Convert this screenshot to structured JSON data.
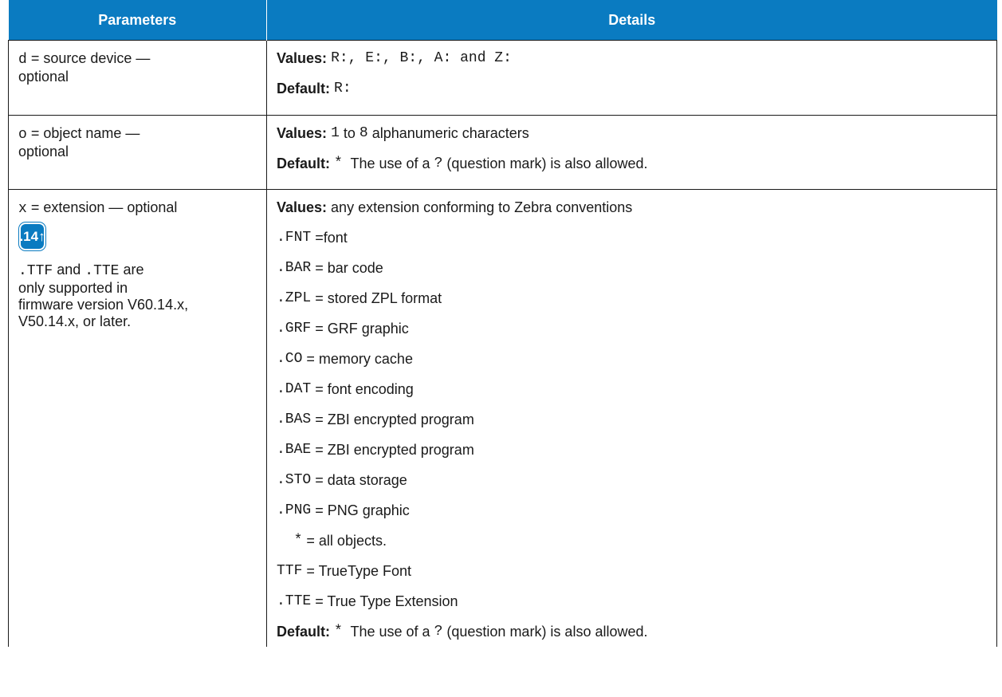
{
  "header": {
    "col1": "Parameters",
    "col2": "Details"
  },
  "rows": [
    {
      "param_code": "d",
      "param_text": " = source device —",
      "param_text2": "optional",
      "values_label": "Values:",
      "values_code": "R:, E:, B:, A: and Z:",
      "default_label": "Default:",
      "default_code": "R:"
    },
    {
      "param_code": "o",
      "param_text": " = object name —",
      "param_text2": "optional",
      "values_label": "Values:",
      "values_pre": "1",
      "values_mid": " to ",
      "values_mid2": "8",
      "values_post": " alphanumeric characters",
      "default_label": "Default:",
      "default_star": "*",
      "default_text1": "  The use of a ",
      "default_q": "?",
      "default_text2": " (question mark) is also allowed."
    },
    {
      "param_code": "x",
      "param_text": " = extension — optional",
      "badge": ".14↑",
      "note_code1": ".TTF",
      "note_and": " and ",
      "note_code2": ".TTE",
      "note_text1": " are",
      "note_text2": "only supported in",
      "note_text3": "firmware version V60.14.x,",
      "note_text4": "V50.14.x, or later.",
      "values_label": "Values:",
      "values_text": " any extension conforming to Zebra conventions",
      "extensions": [
        {
          "code": ".FNT",
          "desc": " =font"
        },
        {
          "code": ".BAR",
          "desc": " = bar code"
        },
        {
          "code": ".ZPL",
          "desc": " = stored ZPL format"
        },
        {
          "code": ".GRF",
          "desc": " = GRF graphic"
        },
        {
          "code": ".CO",
          "desc": " = memory cache"
        },
        {
          "code": ".DAT",
          "desc": " = font encoding"
        },
        {
          "code": ".BAS",
          "desc": " = ZBI encrypted program"
        },
        {
          "code": ".BAE",
          "desc": " = ZBI encrypted program"
        },
        {
          "code": ".STO",
          "desc": " = data storage"
        },
        {
          "code": ".PNG",
          "desc": " = PNG graphic"
        },
        {
          "code": "  *",
          "desc": " = all objects."
        },
        {
          "code": "TTF",
          "desc": " = TrueType Font"
        },
        {
          "code": ".TTE",
          "desc": " = True Type Extension"
        }
      ],
      "default_label": "Default:",
      "default_star": "*",
      "default_text1": "  The use of a ",
      "default_q": "?",
      "default_text2": " (question mark) is also allowed."
    }
  ],
  "colors": {
    "header_bg": "#0a7bc1",
    "header_text": "#ffffff",
    "border": "#1a1a1a"
  },
  "icons": {
    "badge": "version-badge-icon"
  }
}
